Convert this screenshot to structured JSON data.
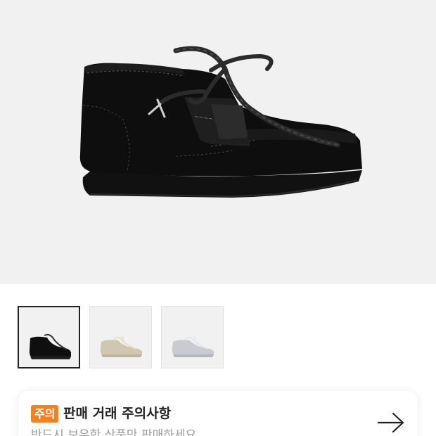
{
  "product": {
    "main_image": "black-suede-wallabee-boot",
    "thumbnails": [
      {
        "name": "black-suede-boot-thumbnail",
        "selected": true
      },
      {
        "name": "beige-boot-thumbnail",
        "selected": false
      },
      {
        "name": "silver-boot-thumbnail",
        "selected": false
      }
    ]
  },
  "notice": {
    "badge": "주의",
    "title": "판매 거래 주의사항",
    "subtitle": "반드시 보유한 상품만 판매하세요.",
    "arrow_icon": "arrow-right-icon"
  },
  "colors": {
    "accent": "#f4811f",
    "background_image": "#f1f1f1",
    "selected_border": "#222222"
  }
}
